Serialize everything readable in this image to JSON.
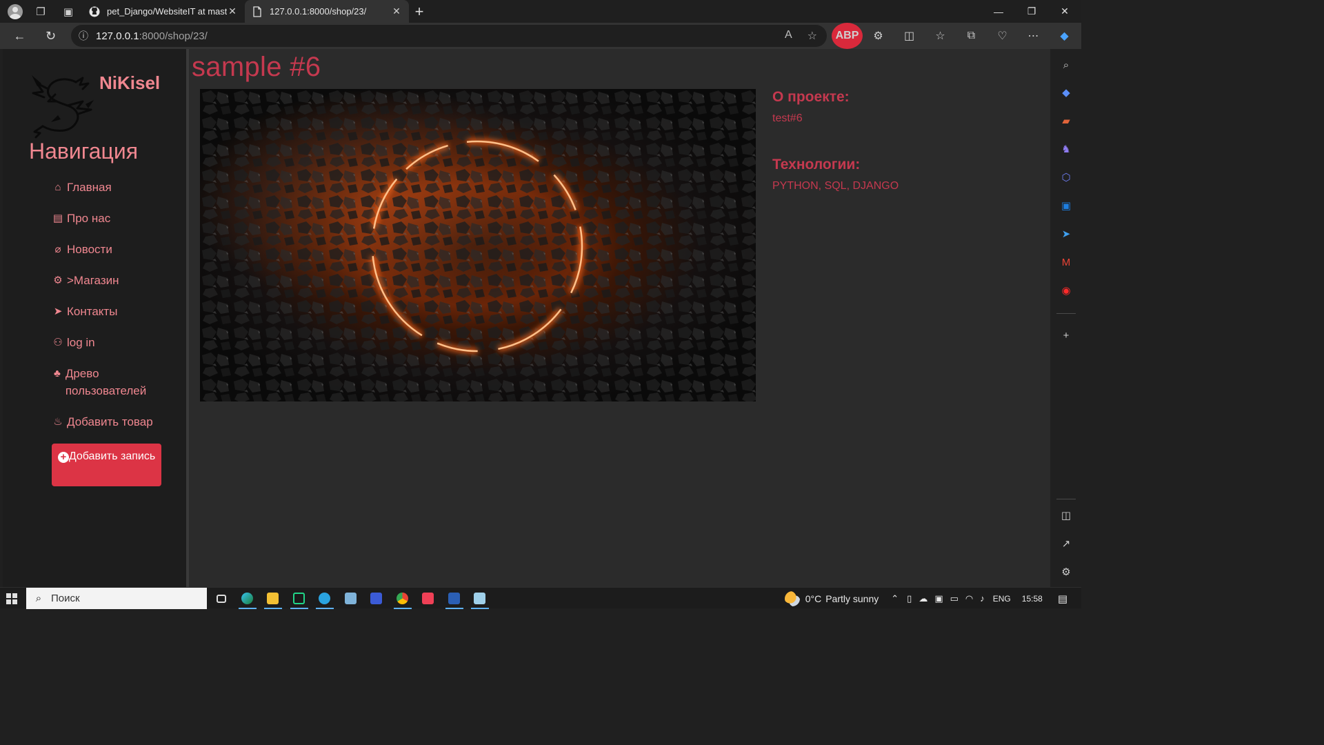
{
  "browser": {
    "tabs": [
      {
        "title": "pet_Django/WebsiteIT at master",
        "active": false,
        "favicon": "github-icon"
      },
      {
        "title": "127.0.0.1:8000/shop/23/",
        "active": true,
        "favicon": "page-icon"
      }
    ],
    "url_host": "127.0.0.1",
    "url_rest": ":8000/shop/23/",
    "abp_label": "ABP"
  },
  "nav": {
    "brand": "NiKisel",
    "title": "Навигация",
    "items": [
      {
        "icon": "home-icon",
        "glyph": "⌂",
        "label": "Главная"
      },
      {
        "icon": "id-card-icon",
        "glyph": "▤",
        "label": "Про нас"
      },
      {
        "icon": "paperclip-icon",
        "glyph": "⌀",
        "label": "Новости"
      },
      {
        "icon": "bicycle-icon",
        "glyph": "⚙",
        "label": ">Магазин"
      },
      {
        "icon": "paper-plane-icon",
        "glyph": "➤",
        "label": "Контакты"
      },
      {
        "icon": "users-icon",
        "glyph": "⚇",
        "label": "log in"
      },
      {
        "icon": "tree-icon",
        "glyph": "♣",
        "label": "Древо пользователей"
      },
      {
        "icon": "fire-icon",
        "glyph": "♨",
        "label": "Добавить товар"
      }
    ],
    "add_button_label": "Добавить запись"
  },
  "product": {
    "title": "sample #6",
    "about_heading": "О проекте:",
    "about_text": "test#6",
    "tech_heading": "Технологии:",
    "tech_text": "PYTHON, SQL, DJANGO"
  },
  "taskbar": {
    "search_placeholder": "Поиск",
    "weather_temp": "0°C",
    "weather_desc": "Partly sunny",
    "language": "ENG",
    "time": "15:58"
  },
  "colors": {
    "accent": "#c5394f",
    "nav_link": "#f08790",
    "button": "#dc3445",
    "page_bg": "#2b2b2b",
    "nav_bg": "#1d1d1d"
  }
}
